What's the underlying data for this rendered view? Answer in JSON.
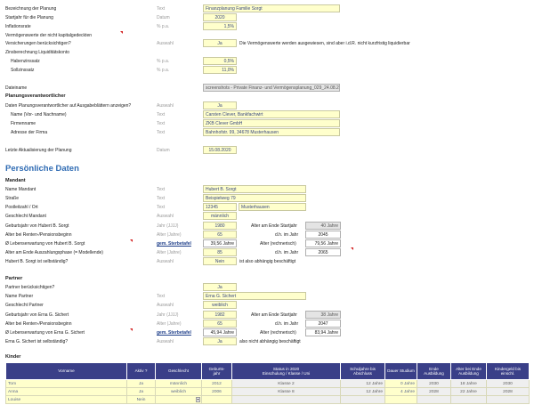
{
  "planung": {
    "bezeichnung": {
      "label": "Bezeichnung der Planung",
      "type": "Text",
      "value": "Finanzplanung Familie Sorgt"
    },
    "startjahr": {
      "label": "Startjahr für die Planung",
      "type": "Datum",
      "value": "2020"
    },
    "inflation": {
      "label": "Inflationsrate",
      "type": "% p.a.",
      "value": "1,5%"
    },
    "vermoegen_label": "Vermögenswerte der nicht kapitalgedeckten",
    "versicherungen": {
      "label": "Versicherungen berücksichtigen?",
      "type": "Auswahl",
      "value": "Ja",
      "note": "Die Vermögenswerte werden ausgewiesen, sind aber i.d.R. nicht kurzfristig liquidierbar"
    },
    "zins_label": "Zinsberechnung Liquiditätskonto",
    "haben": {
      "label": "Habenzinssatz",
      "type": "% p.a.",
      "value": "0,5%"
    },
    "soll": {
      "label": "Sollzinssatz",
      "type": "% p.a.",
      "value": "11,0%"
    }
  },
  "datei": {
    "label": "Dateiname",
    "value": "screenshots - Private Finanz- und Vermögensplanung_029_24.08.2020_Mourad.xlsb"
  },
  "verantwortlicher": {
    "heading": "Planungsverantwortlicher",
    "anzeigen": {
      "label": "Daten Planungsverantwortlicher auf Ausgabeblättern anzeigen?",
      "type": "Auswahl",
      "value": "Ja"
    },
    "name": {
      "label": "Name (Vor- und Nachname)",
      "type": "Text",
      "value": "Carsten Clever, Bankfachwirt"
    },
    "firma": {
      "label": "Firmenname",
      "type": "Text",
      "value": "ZKB Clever GmbH"
    },
    "adresse": {
      "label": "Adresse der Firma",
      "type": "Text",
      "value": "Bahnhofstr. 99, 34678 Musterhausen"
    },
    "aktualisierung": {
      "label": "Letzte Aktualisierung der Planung",
      "type": "Datum",
      "value": "15.08.2020"
    }
  },
  "persoenlich": {
    "heading": "Persönliche Daten",
    "mandant": {
      "heading": "Mandant",
      "name": {
        "label": "Name Mandant",
        "type": "Text",
        "value": "Hubert B. Sorgt"
      },
      "strasse": {
        "label": "Straße",
        "type": "Text",
        "value": "Beispielweg 79"
      },
      "plz": {
        "label": "Postleitzahl / Ort",
        "type": "Text",
        "plz": "12345",
        "ort": "Musterhausen"
      },
      "geschlecht": {
        "label": "Geschlecht Mandant",
        "type": "Auswahl",
        "value": "männlich"
      },
      "geburt": {
        "label": "Geburtsjahr von Hubert B. Sorgt",
        "type": "Jahr (JJJJ)",
        "value": "1980",
        "alter_label": "Alter am Ende Startjahr",
        "alter_value": "40 Jahre"
      },
      "rente": {
        "label": "Alter bei Renten-/Pensionsbeginn",
        "type": "Alter (Jahre)",
        "value": "65",
        "dh_label": "d.h. im Jahr",
        "dh_value": "2045"
      },
      "lebenserwartung": {
        "label": "Ø Lebenserwartung von Hubert B. Sorgt",
        "link": "gem. Sterbetafel",
        "value": "39,56 Jahre",
        "rech_label": "Alter (rechnerisch)",
        "rech_value": "79,56 Jahre"
      },
      "auszahlung": {
        "label": "Alter am Ende Auszahlungsphase (= Modellende)",
        "type": "Alter (Jahre)",
        "value": "85",
        "dh_label": "d.h. im Jahr",
        "dh_value": "2065"
      },
      "selbst": {
        "label": "Hubert B. Sorgt ist selbständig?",
        "type": "Auswahl",
        "value": "Nein",
        "note": "ist also abhängig beschäftigt"
      }
    },
    "partner": {
      "heading": "Partner",
      "beruecksichtigen": {
        "label": "Partner berücksichtigen?",
        "value": "Ja"
      },
      "name": {
        "label": "Name Partner",
        "type": "Text",
        "value": "Erna G. Sichert"
      },
      "geschlecht": {
        "label": "Geschlecht Partner",
        "type": "Auswahl",
        "value": "weiblich"
      },
      "geburt": {
        "label": "Geburtsjahr von Erna G. Sichert",
        "type": "Jahr (JJJJ)",
        "value": "1982",
        "alter_label": "Alter am Ende Startjahr",
        "alter_value": "38 Jahre"
      },
      "rente": {
        "label": "Alter bei Renten-/Pensionsbeginn",
        "type": "Alter (Jahre)",
        "value": "65",
        "dh_label": "d.h. im Jahr",
        "dh_value": "2047"
      },
      "lebenserwartung": {
        "label": "Ø Lebenserwartung von Erna G. Sichert",
        "link": "gem. Sterbetafel",
        "value": "45,94 Jahre",
        "rech_label": "Alter (rechnerisch)",
        "rech_value": "83,94 Jahre"
      },
      "selbst": {
        "label": "Erna G. Sichert ist selbständig?",
        "type": "Auswahl",
        "value": "Ja",
        "note": "also nicht abhängig beschäftigt"
      }
    }
  },
  "kinder": {
    "heading": "Kinder",
    "columns": [
      "Vorname",
      "Aktiv ?",
      "Geschlecht",
      "Geburts-\njahr",
      "Status in 2020\nEinschulung / Klasse / Uni",
      "Schuljahre bis\nAbschluss",
      "Dauer Studium",
      "Ende\nAusbildung",
      "Alter bei Ende\nAusbildung",
      "Kindergeld bis\neinschl."
    ],
    "rows": [
      [
        "Tom",
        "Ja",
        "männlich",
        "2012",
        "Klasse 2",
        "12 Jahre",
        "0 Jahre",
        "2030",
        "18 Jahre",
        "2030"
      ],
      [
        "Anna",
        "Ja",
        "weiblich",
        "2006",
        "Klasse 8",
        "12 Jahre",
        "4 Jahre",
        "2028",
        "22 Jahre",
        "2028"
      ],
      [
        "Louise",
        "Nein",
        "",
        "",
        "",
        "",
        "",
        "",
        "",
        ""
      ]
    ]
  },
  "colors": {
    "accent": "#2f6bb3",
    "input": "#ffffcc",
    "header": "#3a3f88"
  }
}
